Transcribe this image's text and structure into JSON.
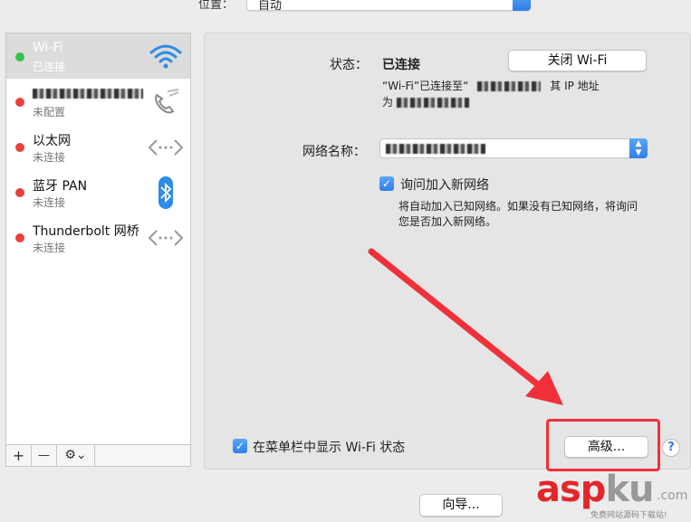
{
  "location": {
    "label": "位置：",
    "value": "自动"
  },
  "sidebar": {
    "items": [
      {
        "name": "Wi-Fi",
        "status": "已连接",
        "state": "green",
        "icon": "wifi-icon"
      },
      {
        "name": "",
        "status": "未配置",
        "state": "red",
        "icon": "phone-icon"
      },
      {
        "name": "以太网",
        "status": "未连接",
        "state": "red",
        "icon": "ethernet-icon"
      },
      {
        "name": "蓝牙 PAN",
        "status": "未连接",
        "state": "red",
        "icon": "bluetooth-icon"
      },
      {
        "name": "Thunderbolt 网桥",
        "status": "未连接",
        "state": "red",
        "icon": "ethernet-icon"
      }
    ],
    "footer": {
      "add": "+",
      "remove": "—",
      "gear": "⚙⌄"
    }
  },
  "main": {
    "status_label": "状态：",
    "status_value": "已连接",
    "toggle_wifi_button": "关闭 Wi-Fi",
    "status_desc_1": "“Wi-Fi”已连接至“",
    "status_desc_2": "其 IP 地址",
    "status_desc_3": "为",
    "network_name_label": "网络名称：",
    "ask_join_label": "询问加入新网络",
    "ask_join_desc_1": "将自动加入已知网络。如果没有已知网络，将询问",
    "ask_join_desc_2": "您是否加入新网络。",
    "show_menu_label": "在菜单栏中显示 Wi-Fi 状态",
    "advanced_button": "高级...",
    "help_button": "?",
    "assistant_button": "向导..."
  },
  "watermark": {
    "main_a": "asp",
    "main_b": "ku",
    "com": ".com",
    "sub": "免费网站源码下载站!"
  },
  "colors": {
    "accent": "#2f7ee8",
    "connected": "#36c24a",
    "disconnected": "#e9403e",
    "annotation": "#f0303a"
  }
}
